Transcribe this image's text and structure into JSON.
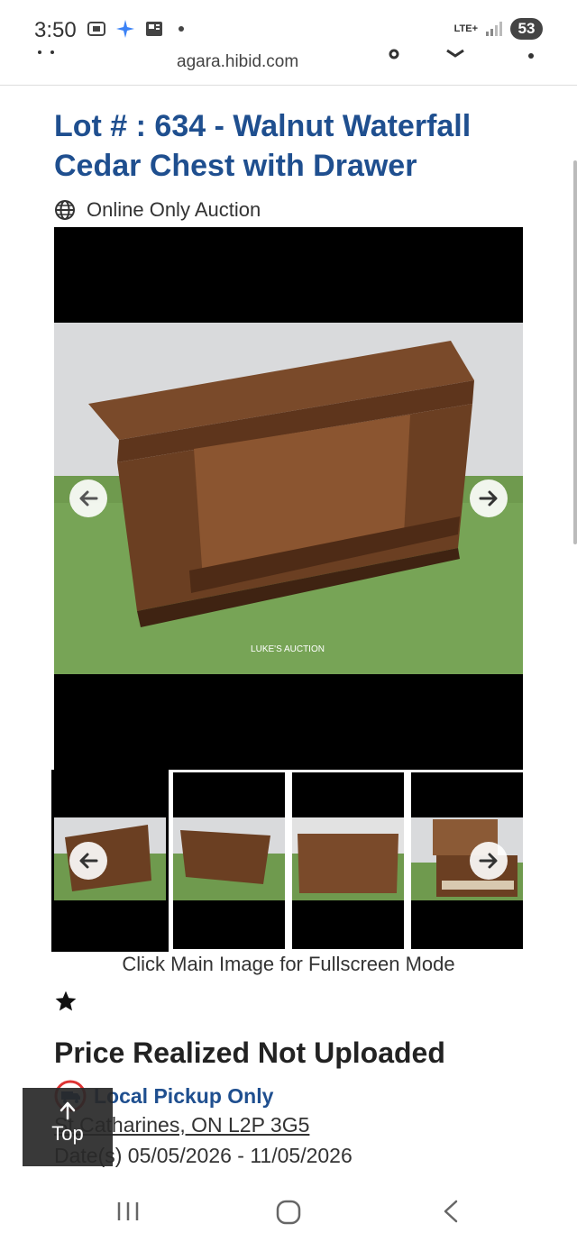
{
  "status_bar": {
    "time": "3:50",
    "network": "LTE+",
    "battery": "53"
  },
  "browser": {
    "url": "agara.hibid.com"
  },
  "lot": {
    "title": "Lot # : 634 - Walnut Waterfall Cedar Chest with Drawer",
    "auction_type": "Online Only Auction",
    "watermark": "LUKE'S AUCTION",
    "image_caption": "Click Main Image for Fullscreen Mode",
    "price_status": "Price Realized Not Uploaded",
    "pickup": "Local Pickup Only",
    "location": "St Catharines, ON L2P 3G5",
    "dates": "Date(s) 05/05/2026 - 11/05/2026"
  },
  "top_button": {
    "label": "Top"
  },
  "colors": {
    "title": "#1f4f8f",
    "black_frame": "#000000"
  },
  "icons": [
    "globe-icon",
    "arrow-left-icon",
    "arrow-right-icon",
    "star-icon",
    "truck-icon",
    "arrow-up-icon",
    "recents-icon",
    "home-icon",
    "back-icon"
  ]
}
